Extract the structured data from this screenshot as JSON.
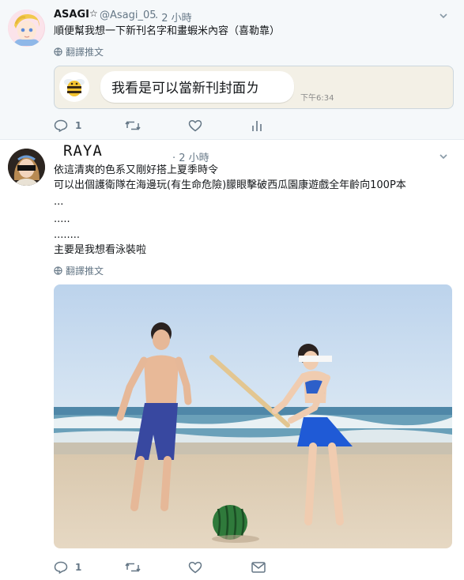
{
  "tweet1": {
    "display_name": "ASAGI",
    "handle": "@Asagi_05",
    "time": "· 2 小時",
    "text": "順便幫我想一下新刊名字和畫蝦米內容（喜勒靠）",
    "translate": "翻譯推文",
    "chat_message": "我看是可以當新刊封面ㄌ",
    "chat_time": "下午6:34",
    "reply_count": "1"
  },
  "tweet2": {
    "display_name": "RAYA",
    "time": "· 2 小時",
    "lines": [
      "依這清爽的色系又剛好搭上夏季時令",
      "可以出個護衛隊在海邊玩(有生命危險)朦眼擊破西瓜園康遊戲全年齡向100P本",
      "...",
      ".....",
      "........",
      "主要是我想看泳裝啦"
    ],
    "translate": "翻譯推文",
    "reply_count": "1"
  }
}
